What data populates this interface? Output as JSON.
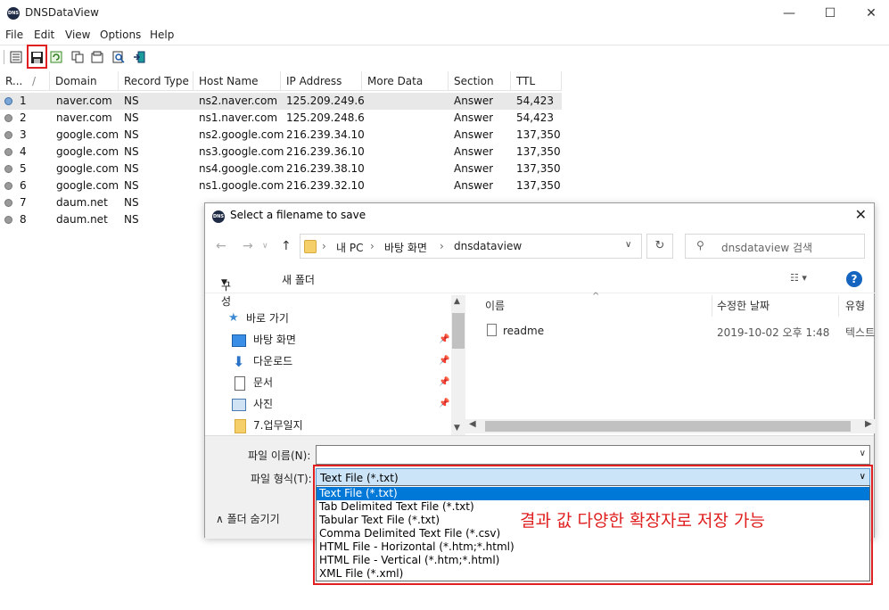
{
  "window": {
    "title": "DNSDataView",
    "app_icon": "DNS",
    "controls": [
      "—",
      "☐",
      "✕"
    ]
  },
  "menu": [
    "File",
    "Edit",
    "View",
    "Options",
    "Help"
  ],
  "toolbar_icons": [
    "report-icon",
    "save-icon",
    "refresh-icon",
    "copy-icon",
    "properties-icon",
    "find-icon",
    "exit-icon"
  ],
  "table": {
    "columns": [
      "R...",
      "Domain",
      "Record Type",
      "Host Name",
      "IP Address",
      "More Data",
      "Section",
      "TTL"
    ],
    "sort_indicator": "/",
    "rows": [
      {
        "n": "1",
        "domain": "naver.com",
        "type": "NS",
        "host": "ns2.naver.com",
        "ip": "125.209.249.6",
        "more": "",
        "section": "Answer",
        "ttl": "54,423"
      },
      {
        "n": "2",
        "domain": "naver.com",
        "type": "NS",
        "host": "ns1.naver.com",
        "ip": "125.209.248.6",
        "more": "",
        "section": "Answer",
        "ttl": "54,423"
      },
      {
        "n": "3",
        "domain": "google.com",
        "type": "NS",
        "host": "ns2.google.com",
        "ip": "216.239.34.10",
        "more": "",
        "section": "Answer",
        "ttl": "137,350"
      },
      {
        "n": "4",
        "domain": "google.com",
        "type": "NS",
        "host": "ns3.google.com",
        "ip": "216.239.36.10",
        "more": "",
        "section": "Answer",
        "ttl": "137,350"
      },
      {
        "n": "5",
        "domain": "google.com",
        "type": "NS",
        "host": "ns4.google.com",
        "ip": "216.239.38.10",
        "more": "",
        "section": "Answer",
        "ttl": "137,350"
      },
      {
        "n": "6",
        "domain": "google.com",
        "type": "NS",
        "host": "ns1.google.com",
        "ip": "216.239.32.10",
        "more": "",
        "section": "Answer",
        "ttl": "137,350"
      },
      {
        "n": "7",
        "domain": "daum.net",
        "type": "NS",
        "host": "",
        "ip": "",
        "more": "",
        "section": "",
        "ttl": ""
      },
      {
        "n": "8",
        "domain": "daum.net",
        "type": "NS",
        "host": "",
        "ip": "",
        "more": "",
        "section": "",
        "ttl": ""
      }
    ]
  },
  "dialog": {
    "title": "Select a filename to save",
    "close": "✕",
    "breadcrumb": [
      "내 PC",
      "바탕 화면",
      "dnsdataview"
    ],
    "search_placeholder": "dnsdataview 검색",
    "organize": "구성",
    "new_folder": "새 폴더",
    "help": "?",
    "nav": {
      "quick_access": "바로 가기",
      "items": [
        "바탕 화면",
        "다운로드",
        "문서",
        "사진",
        "7.업무일지"
      ]
    },
    "file_columns": [
      "이름",
      "수정한 날짜",
      "유형"
    ],
    "files": [
      {
        "name": "readme",
        "modified": "2019-10-02 오후 1:48",
        "type": "텍스트"
      }
    ],
    "filename_label": "파일 이름(N):",
    "filename_value": "",
    "filetype_label": "파일 형식(T):",
    "filetype_value": "Text File (*.txt)",
    "hide_folders": "폴더 숨기기",
    "filetype_options": [
      "Text File (*.txt)",
      "Tab Delimited Text File (*.txt)",
      "Tabular Text File (*.txt)",
      "Comma Delimited Text File (*.csv)",
      "HTML File - Horizontal (*.htm;*.html)",
      "HTML File - Vertical (*.htm;*.html)",
      "XML File (*.xml)"
    ]
  },
  "annotation": "결과 값 다양한 확장자로 저장 가능",
  "colors": {
    "highlight": "#e02020",
    "selection": "#0078d7"
  }
}
